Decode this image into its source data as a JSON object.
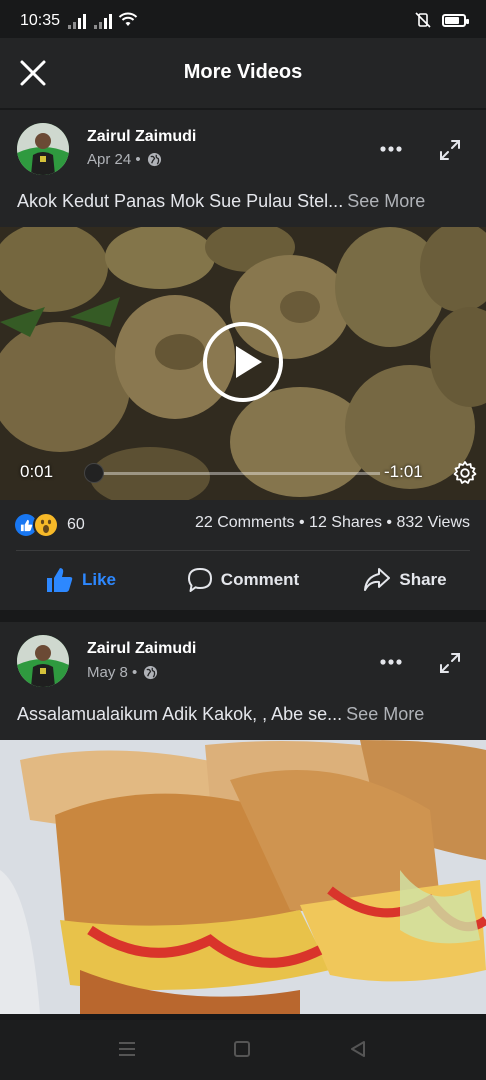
{
  "status_bar": {
    "time": "10:35"
  },
  "header": {
    "title": "More Videos"
  },
  "posts": [
    {
      "author": "Zairul Zaimudi",
      "date": "Apr 24 •",
      "caption": "Akok Kedut Panas Mok Sue Pulau Stel...",
      "see_more": "See More",
      "video": {
        "current_time": "0:01",
        "remaining_time": "-1:01",
        "progress": 0.01
      },
      "reaction_count": "60",
      "counts": "22 Comments • 12 Shares • 832 Views",
      "actions": {
        "like": "Like",
        "comment": "Comment",
        "share": "Share"
      }
    },
    {
      "author": "Zairul Zaimudi",
      "date": "May 8 •",
      "caption": "Assalamualaikum Adik Kakok, , Abe se...",
      "see_more": "See More"
    }
  ],
  "colors": {
    "accent": "#2d88ff",
    "background": "#18191a",
    "card": "#242526"
  },
  "icons": [
    "close-icon",
    "globe-icon",
    "more-icon",
    "expand-icon",
    "play-icon",
    "gear-icon",
    "like-icon",
    "comment-icon",
    "share-icon"
  ]
}
